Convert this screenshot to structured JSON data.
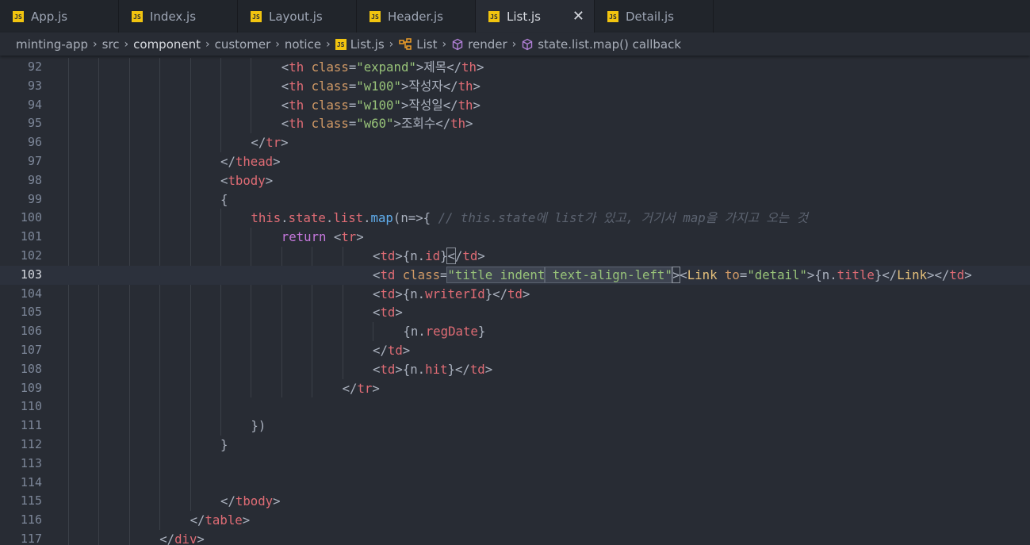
{
  "tabs": [
    {
      "label": "App.js",
      "active": false
    },
    {
      "label": "Index.js",
      "active": false
    },
    {
      "label": "Layout.js",
      "active": false
    },
    {
      "label": "Header.js",
      "active": false
    },
    {
      "label": "List.js",
      "active": true
    },
    {
      "label": "Detail.js",
      "active": false
    }
  ],
  "breadcrumb": {
    "items": [
      "minting-app",
      "src",
      "component",
      "customer",
      "notice",
      "List.js",
      "List",
      "render",
      "state.list.map() callback"
    ]
  },
  "editor": {
    "current_line": "103",
    "lines": [
      {
        "num": "92",
        "indent": 7,
        "tokens": [
          [
            "t-punc",
            "<"
          ],
          [
            "t-tag",
            "th"
          ],
          [
            "t-punc",
            " "
          ],
          [
            "t-attr",
            "class"
          ],
          [
            "t-punc",
            "="
          ],
          [
            "t-str",
            "\"expand\""
          ],
          [
            "t-punc",
            ">제목</"
          ],
          [
            "t-tag",
            "th"
          ],
          [
            "t-punc",
            ">"
          ]
        ]
      },
      {
        "num": "93",
        "indent": 7,
        "tokens": [
          [
            "t-punc",
            "<"
          ],
          [
            "t-tag",
            "th"
          ],
          [
            "t-punc",
            " "
          ],
          [
            "t-attr",
            "class"
          ],
          [
            "t-punc",
            "="
          ],
          [
            "t-str",
            "\"w100\""
          ],
          [
            "t-punc",
            ">작성자</"
          ],
          [
            "t-tag",
            "th"
          ],
          [
            "t-punc",
            ">"
          ]
        ]
      },
      {
        "num": "94",
        "indent": 7,
        "tokens": [
          [
            "t-punc",
            "<"
          ],
          [
            "t-tag",
            "th"
          ],
          [
            "t-punc",
            " "
          ],
          [
            "t-attr",
            "class"
          ],
          [
            "t-punc",
            "="
          ],
          [
            "t-str",
            "\"w100\""
          ],
          [
            "t-punc",
            ">작성일</"
          ],
          [
            "t-tag",
            "th"
          ],
          [
            "t-punc",
            ">"
          ]
        ]
      },
      {
        "num": "95",
        "indent": 7,
        "tokens": [
          [
            "t-punc",
            "<"
          ],
          [
            "t-tag",
            "th"
          ],
          [
            "t-punc",
            " "
          ],
          [
            "t-attr",
            "class"
          ],
          [
            "t-punc",
            "="
          ],
          [
            "t-str",
            "\"w60\""
          ],
          [
            "t-punc",
            ">조회수</"
          ],
          [
            "t-tag",
            "th"
          ],
          [
            "t-punc",
            ">"
          ]
        ]
      },
      {
        "num": "96",
        "indent": 6,
        "tokens": [
          [
            "t-punc",
            "</"
          ],
          [
            "t-tag",
            "tr"
          ],
          [
            "t-punc",
            ">"
          ]
        ]
      },
      {
        "num": "97",
        "indent": 5,
        "tokens": [
          [
            "t-punc",
            "</"
          ],
          [
            "t-tag",
            "thead"
          ],
          [
            "t-punc",
            ">"
          ]
        ]
      },
      {
        "num": "98",
        "indent": 5,
        "tokens": [
          [
            "t-punc",
            "<"
          ],
          [
            "t-tag",
            "tbody"
          ],
          [
            "t-punc",
            ">"
          ]
        ]
      },
      {
        "num": "99",
        "indent": 5,
        "tokens": [
          [
            "t-punc",
            "{"
          ]
        ]
      },
      {
        "num": "100",
        "indent": 6,
        "tokens": [
          [
            "t-var",
            "this"
          ],
          [
            "t-punc",
            "."
          ],
          [
            "t-var",
            "state"
          ],
          [
            "t-punc",
            "."
          ],
          [
            "t-var",
            "list"
          ],
          [
            "t-punc",
            "."
          ],
          [
            "t-fn",
            "map"
          ],
          [
            "t-punc",
            "(n=>{ "
          ],
          [
            "t-cmt",
            "// this.state에 list가 있고, 거기서 map을 가지고 오는 것"
          ]
        ]
      },
      {
        "num": "101",
        "indent": 7,
        "tokens": [
          [
            "t-kw",
            "return"
          ],
          [
            "t-punc",
            " <"
          ],
          [
            "t-tag",
            "tr"
          ],
          [
            "t-punc",
            ">"
          ]
        ]
      },
      {
        "num": "102",
        "indent": 10,
        "tokens": [
          [
            "t-punc",
            "<"
          ],
          [
            "t-tag",
            "td"
          ],
          [
            "t-punc",
            ">{n."
          ],
          [
            "t-var",
            "id"
          ],
          [
            "t-punc",
            "}"
          ],
          [
            "t-punc bracket-box",
            "<"
          ],
          [
            "t-punc",
            "/"
          ],
          [
            "t-tag",
            "td"
          ],
          [
            "t-punc",
            ">"
          ]
        ]
      },
      {
        "num": "103",
        "indent": 10,
        "tokens": [
          [
            "t-punc",
            "<"
          ],
          [
            "t-tag",
            "td"
          ],
          [
            "t-punc",
            " "
          ],
          [
            "t-attr",
            "class"
          ],
          [
            "t-punc",
            "="
          ],
          [
            "t-str hl",
            "\"title indent"
          ],
          [
            "caret",
            ""
          ],
          [
            "t-str hl",
            " text-align-left\""
          ],
          [
            "t-punc bracket-box",
            ">"
          ],
          [
            "t-punc",
            "<"
          ],
          [
            "t-comp",
            "Link"
          ],
          [
            "t-punc",
            " "
          ],
          [
            "t-attr",
            "to"
          ],
          [
            "t-punc",
            "="
          ],
          [
            "t-str",
            "\"detail\""
          ],
          [
            "t-punc",
            ">{n."
          ],
          [
            "t-var",
            "title"
          ],
          [
            "t-punc",
            "}</"
          ],
          [
            "t-comp",
            "Link"
          ],
          [
            "t-punc",
            "></"
          ],
          [
            "t-tag",
            "td"
          ],
          [
            "t-punc",
            ">"
          ]
        ]
      },
      {
        "num": "104",
        "indent": 10,
        "tokens": [
          [
            "t-punc",
            "<"
          ],
          [
            "t-tag",
            "td"
          ],
          [
            "t-punc",
            ">{n."
          ],
          [
            "t-var",
            "writerId"
          ],
          [
            "t-punc",
            "}</"
          ],
          [
            "t-tag",
            "td"
          ],
          [
            "t-punc",
            ">"
          ]
        ]
      },
      {
        "num": "105",
        "indent": 10,
        "tokens": [
          [
            "t-punc",
            "<"
          ],
          [
            "t-tag",
            "td"
          ],
          [
            "t-punc",
            ">"
          ]
        ]
      },
      {
        "num": "106",
        "indent": 11,
        "tokens": [
          [
            "t-punc",
            "{n."
          ],
          [
            "t-var",
            "regDate"
          ],
          [
            "t-punc",
            "}"
          ]
        ]
      },
      {
        "num": "107",
        "indent": 10,
        "tokens": [
          [
            "t-punc",
            "</"
          ],
          [
            "t-tag",
            "td"
          ],
          [
            "t-punc",
            ">"
          ]
        ]
      },
      {
        "num": "108",
        "indent": 10,
        "tokens": [
          [
            "t-punc",
            "<"
          ],
          [
            "t-tag",
            "td"
          ],
          [
            "t-punc",
            ">{n."
          ],
          [
            "t-var",
            "hit"
          ],
          [
            "t-punc",
            "}</"
          ],
          [
            "t-tag",
            "td"
          ],
          [
            "t-punc",
            ">"
          ]
        ]
      },
      {
        "num": "109",
        "indent": 9,
        "tokens": [
          [
            "t-punc",
            "</"
          ],
          [
            "t-tag",
            "tr"
          ],
          [
            "t-punc",
            ">"
          ]
        ]
      },
      {
        "num": "110",
        "indent": 0,
        "tokens": []
      },
      {
        "num": "111",
        "indent": 6,
        "tokens": [
          [
            "t-punc",
            "})"
          ]
        ]
      },
      {
        "num": "112",
        "indent": 5,
        "tokens": [
          [
            "t-punc",
            "}"
          ]
        ]
      },
      {
        "num": "113",
        "indent": 0,
        "tokens": []
      },
      {
        "num": "114",
        "indent": 0,
        "tokens": []
      },
      {
        "num": "115",
        "indent": 5,
        "tokens": [
          [
            "t-punc",
            "</"
          ],
          [
            "t-tag",
            "tbody"
          ],
          [
            "t-punc",
            ">"
          ]
        ]
      },
      {
        "num": "116",
        "indent": 4,
        "tokens": [
          [
            "t-punc",
            "</"
          ],
          [
            "t-tag",
            "table"
          ],
          [
            "t-punc",
            ">"
          ]
        ]
      },
      {
        "num": "117",
        "indent": 3,
        "tokens": [
          [
            "t-punc",
            "</"
          ],
          [
            "t-tag",
            "div"
          ],
          [
            "t-punc",
            ">"
          ]
        ]
      }
    ]
  },
  "colors": {
    "background": "#282c34",
    "tab_bar": "#21252b",
    "js_icon": "#f1c40f",
    "tag": "#e06c75",
    "attribute": "#d19a66",
    "string": "#98c379",
    "keyword": "#c678dd",
    "function": "#61afef",
    "comment": "#5c6370",
    "component": "#e5c07b"
  },
  "icons": {
    "tab_file": "js-file-icon",
    "tab_close": "close-icon",
    "breadcrumb_separator": "chevron-right-icon",
    "breadcrumb_class": "class-icon",
    "breadcrumb_method": "method-cube-icon"
  }
}
